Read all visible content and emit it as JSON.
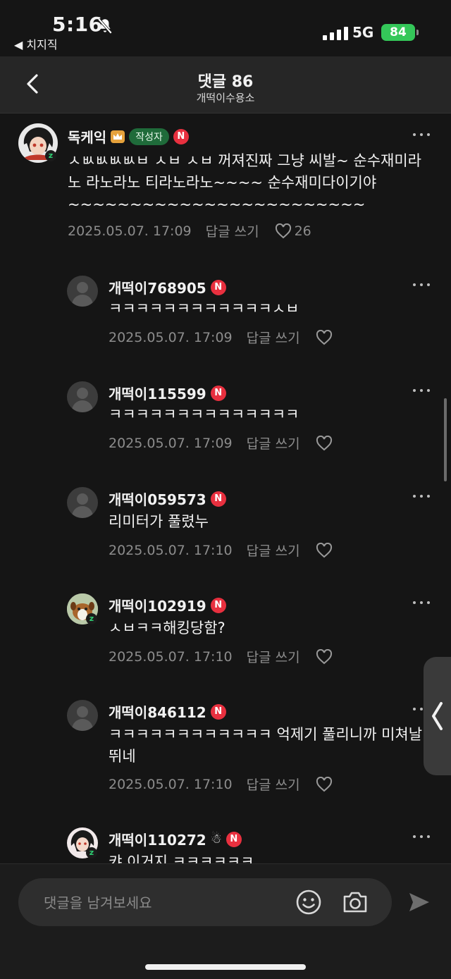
{
  "status_bar": {
    "time": "5:16",
    "back_app": "◀ 치지직",
    "network": "5G",
    "battery": "84"
  },
  "header": {
    "title": "댓글 86",
    "subtitle": "개떡이수용소"
  },
  "comments": [
    {
      "name": "독케익",
      "author_badge": "작성자",
      "text": "ㅅㅄㅄㅄㅄㅂ ㅅㅂ ㅅㅂ 꺼져진짜 그냥 씨발~ 순수재미라노 라노라노 티라노라노~~~~ 순수재미다이기야~~~~~~~~~~~~~~~~~~~~~~~~",
      "date": "2025.05.07. 17:09",
      "reply": "답글 쓰기",
      "likes": "26"
    },
    {
      "name": "개떡이768905",
      "text": "ㅋㅋㅋㅋㅋㅋㅋㅋㅋㅋㅋㅋㅅㅂ",
      "date": "2025.05.07. 17:09",
      "reply": "답글 쓰기"
    },
    {
      "name": "개떡이115599",
      "text": "ㅋㅋㅋㅋㅋㅋㅋㅋㅋㅋㅋㅋㅋㅋ",
      "date": "2025.05.07. 17:09",
      "reply": "답글 쓰기"
    },
    {
      "name": "개떡이059573",
      "text": "리미터가 풀렸누",
      "date": "2025.05.07. 17:10",
      "reply": "답글 쓰기"
    },
    {
      "name": "개떡이102919",
      "text": "ㅅㅂㅋㅋ해킹당함?",
      "date": "2025.05.07. 17:10",
      "reply": "답글 쓰기"
    },
    {
      "name": "개떡이846112",
      "text": "ㅋㅋㅋㅋㅋㅋㅋㅋㅋㅋㅋㅋ 억제기 풀리니까 미쳐날뛰네",
      "date": "2025.05.07. 17:10",
      "reply": "답글 쓰기"
    },
    {
      "name": "개떡이110272",
      "text": "캬 이거지 ㅋㅋㅋㅋㅋㅋ",
      "date": "",
      "reply": ""
    }
  ],
  "input": {
    "placeholder": "댓글을 남겨보세요"
  },
  "n_badge_letter": "N",
  "icons": [
    "bell-slash-icon",
    "back-chevron-icon",
    "crown-icon",
    "more-icon",
    "heart-icon",
    "emoji-icon",
    "camera-icon",
    "send-icon",
    "side-panel-chevron-icon"
  ],
  "colors": {
    "background": "#151515",
    "header": "#262626",
    "n_badge": "#e8303f",
    "author_badge": "#1f6b3a",
    "battery": "#34c759"
  }
}
